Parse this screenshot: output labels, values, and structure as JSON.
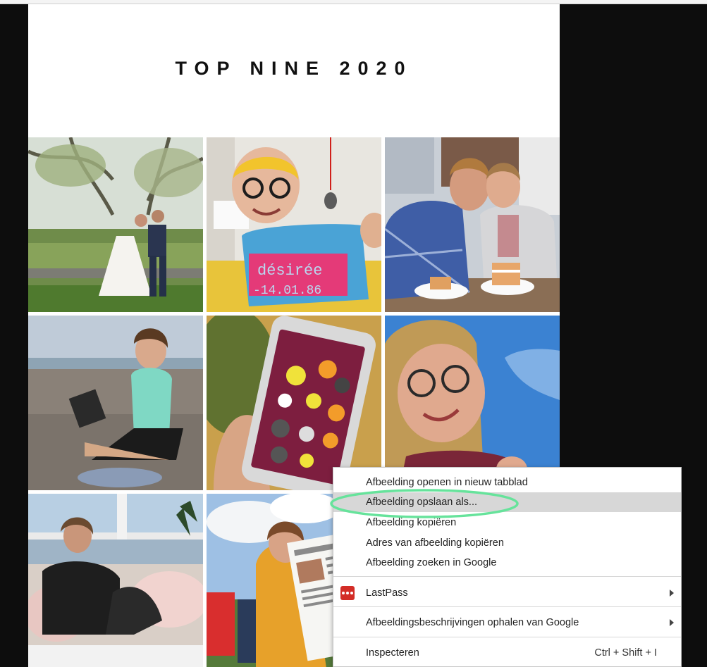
{
  "page": {
    "title": "TOP NINE 2020"
  },
  "photos": [
    {
      "name": "wedding-couple-photo"
    },
    {
      "name": "knitted-sweater-selfie-photo"
    },
    {
      "name": "couple-with-cake-photo"
    },
    {
      "name": "beach-laptop-photo"
    },
    {
      "name": "phone-app-photo"
    },
    {
      "name": "sky-selfie-photo"
    },
    {
      "name": "balcony-sunset-photo"
    },
    {
      "name": "newspaper-photo"
    }
  ],
  "context_menu": {
    "items": [
      {
        "label": "Afbeelding openen in nieuw tabblad"
      },
      {
        "label": "Afbeelding opslaan als..."
      },
      {
        "label": "Afbeelding kopiëren"
      },
      {
        "label": "Adres van afbeelding kopiëren"
      },
      {
        "label": "Afbeelding zoeken in Google"
      },
      {
        "label": "LastPass"
      },
      {
        "label": "Afbeeldingsbeschrijvingen ophalen van Google"
      },
      {
        "label": "Inspecteren"
      }
    ],
    "inspect_shortcut": "Ctrl + Shift + I",
    "highlighted_index": 1,
    "highlight_ring_color": "#66e39b",
    "lastpass_icon_color": "#d32d27"
  }
}
